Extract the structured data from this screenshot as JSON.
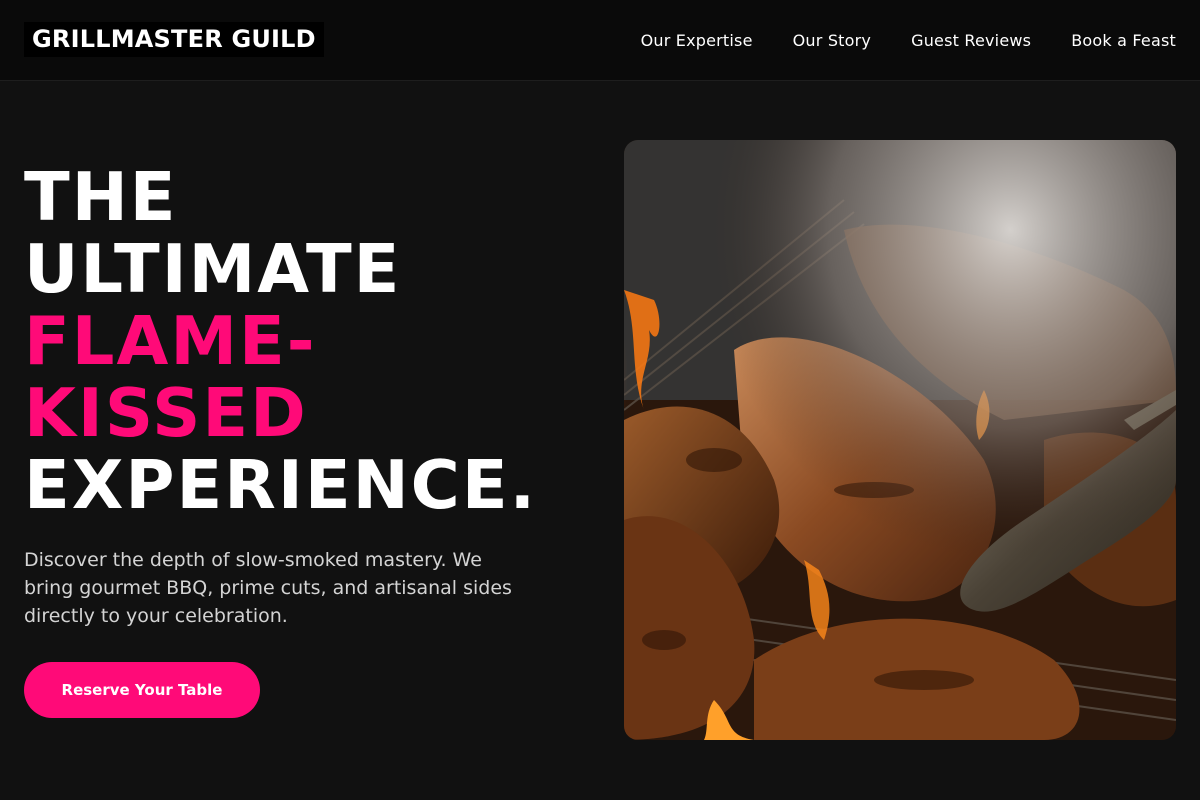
{
  "header": {
    "brand": "GRILLMASTER GUILD",
    "nav": [
      {
        "label": "Our Expertise"
      },
      {
        "label": "Our Story"
      },
      {
        "label": "Guest Reviews"
      },
      {
        "label": "Book a Feast"
      }
    ]
  },
  "hero": {
    "headline": {
      "line1": "THE",
      "line2": "ULTIMATE",
      "line3": "FLAME-",
      "line4": "KISSED",
      "line5": "EXPERIENCE."
    },
    "description": "Discover the depth of slow-smoked mastery. We bring gourmet BBQ, prime cuts, and artisanal sides directly to your celebration.",
    "cta_label": "Reserve Your Table",
    "image": {
      "subject": "grilled meats over open flame with tongs"
    }
  },
  "colors": {
    "accent": "#ff0a78",
    "background": "#111111",
    "header_background": "#0a0a0a",
    "text": "#ffffff",
    "muted_text": "#d4d4d4"
  }
}
